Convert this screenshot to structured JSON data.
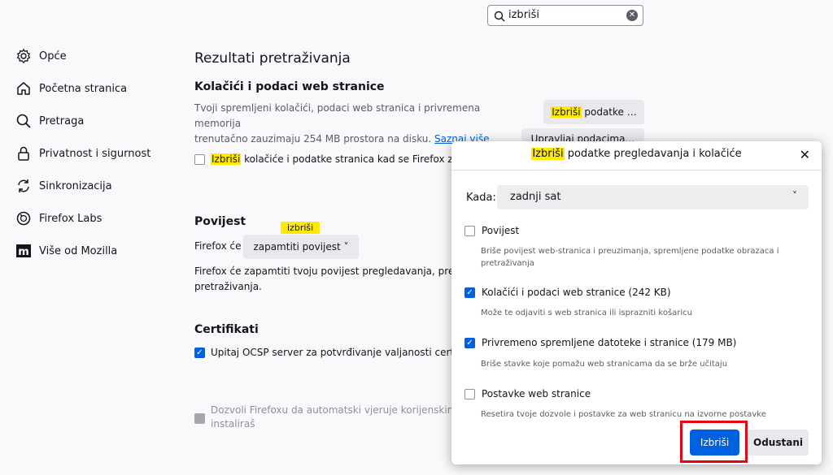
{
  "search": {
    "value": "izbriši"
  },
  "sidebar": {
    "items": [
      {
        "label": "Opće",
        "icon": "gear-icon"
      },
      {
        "label": "Početna stranica",
        "icon": "home-icon"
      },
      {
        "label": "Pretraga",
        "icon": "search-icon"
      },
      {
        "label": "Privatnost i sigurnost",
        "icon": "lock-icon"
      },
      {
        "label": "Sinkronizacija",
        "icon": "sync-icon"
      },
      {
        "label": "Firefox Labs",
        "icon": "labs-icon"
      },
      {
        "label": "Više od Mozilla",
        "icon": "mozilla-icon"
      }
    ]
  },
  "main": {
    "title": "Rezultati pretraživanja",
    "cookies": {
      "heading": "Kolačići i podaci web stranice",
      "desc_line1": "Tvoji spremljeni kolačići, podaci web stranica i privremena memorija",
      "desc_line2": "trenutačno zauzimaju 254 MB prostora na disku.",
      "learn_more": "Saznaj više",
      "delete_btn_hl": "Izbriši",
      "delete_btn_rest": " podatke …",
      "manage_btn": "Upravljaj podacima…",
      "checkbox_hl": "Izbriši",
      "checkbox_rest": " kolačiće i podatke stranica kad se Firefox zatvori"
    },
    "history": {
      "heading": "Povijest",
      "tooltip": "izbriši",
      "prefix": "Firefox će",
      "dropdown": "zapamtiti povijest",
      "desc_line1": "Firefox će zapamtiti tvoju povijest pregledavanja, preuzimanja i pretraživanja",
      "desc_line2": "pretraživanja."
    },
    "certs": {
      "heading": "Certifikati",
      "ocsp": "Upitaj OCSP server za potvrđivanje valjanosti certifikata",
      "auto_line1": "Dozvoli Firefoxu da automatski vjeruje korijenskim certifikatima koje",
      "auto_line2": "instaliraš"
    }
  },
  "dialog": {
    "title_hl": "Izbriši",
    "title_rest": " podatke pregledavanja i kolačiće",
    "when_label": "Kada:",
    "when_value": "zadnji sat",
    "options": [
      {
        "label": "Povijest",
        "desc": "Briše povijest web-stranica i preuzimanja, spremljene podatke obrazaca i pretraživanja",
        "checked": false
      },
      {
        "label": "Kolačići i podaci web stranice (242 KB)",
        "desc": "Može te odjaviti s web stranica ili isprazniti košaricu",
        "checked": true
      },
      {
        "label": "Privremeno spremljene datoteke i stranice (179 MB)",
        "desc": "Briše stavke koje pomažu web stranicama da se brže učitaju",
        "checked": true
      },
      {
        "label": "Postavke web stranice",
        "desc": "Resetira tvoje dozvole i postavke za web stranicu na izvorne postavke",
        "checked": false
      }
    ],
    "primary_label": "Izbriši",
    "secondary_label": "Odustani"
  },
  "colors": {
    "accent": "#0061e0",
    "highlight": "#ffe900",
    "annotation": "#e30613"
  }
}
